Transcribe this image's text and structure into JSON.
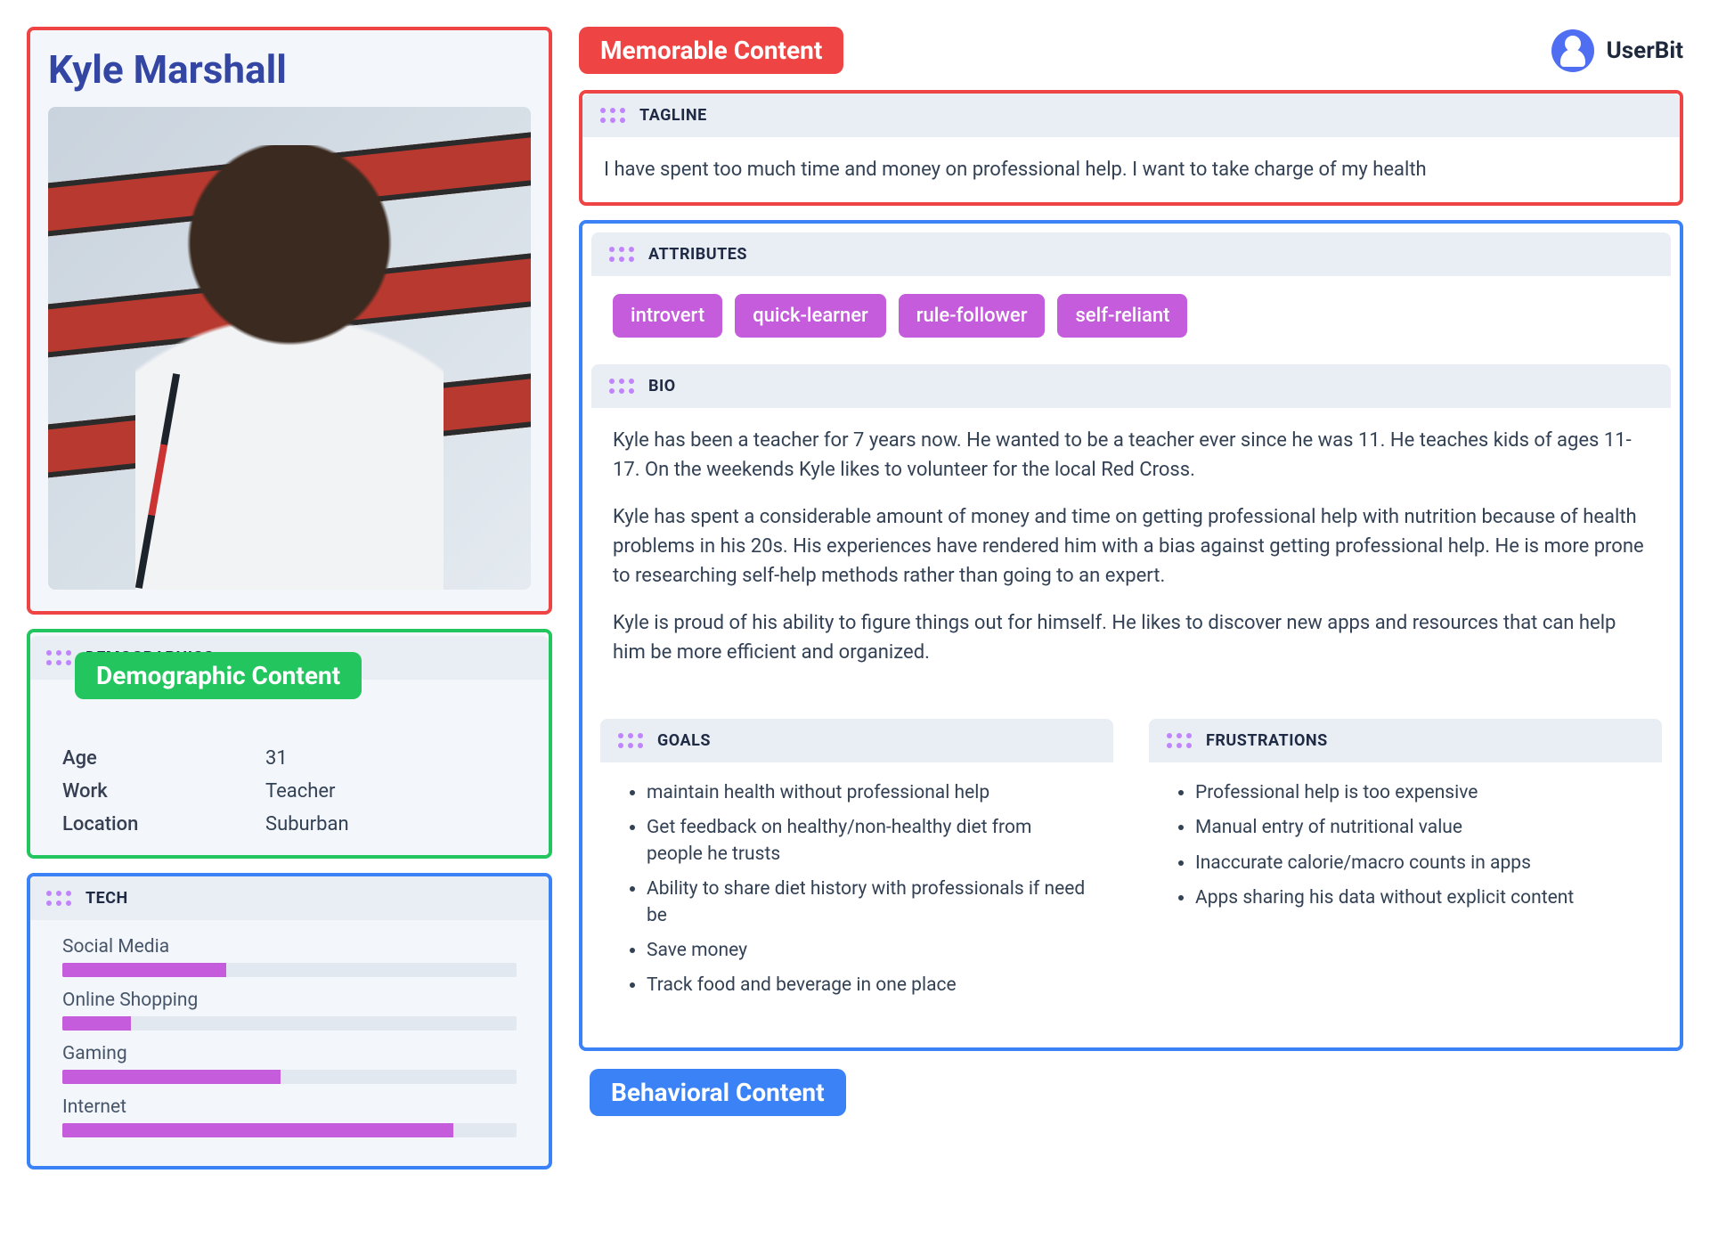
{
  "brand": {
    "name": "UserBit"
  },
  "annotations": {
    "memorable": "Memorable Content",
    "demographic": "Demographic Content",
    "behavioral": "Behavioral Content"
  },
  "persona": {
    "name": "Kyle Marshall",
    "tagline_heading": "TAGLINE",
    "tagline": "I have spent too much time and money on professional help. I want to take charge of my health",
    "attributes_heading": "ATTRIBUTES",
    "attributes": [
      "introvert",
      "quick-learner",
      "rule-follower",
      "self-reliant"
    ],
    "bio_heading": "BIO",
    "bio": [
      "Kyle has been a teacher for 7 years now. He wanted to be a teacher ever since he was 11. He teaches kids of ages 11-17. On the weekends Kyle likes to volunteer for the local Red Cross.",
      "Kyle has spent a considerable amount of money and time on getting professional help with nutrition because of health problems in his 20s. His experiences have rendered him with a bias against getting professional help. He is more prone to researching self-help methods rather than going to an expert.",
      "Kyle is proud of his ability to figure things out for himself. He likes to discover new apps and resources that can help him be more efficient and organized."
    ],
    "demographics_heading": "DEMOGRAPHICS",
    "demographics": [
      {
        "k": "Age",
        "v": "31"
      },
      {
        "k": "Work",
        "v": "Teacher"
      },
      {
        "k": "Location",
        "v": "Suburban"
      }
    ],
    "tech_heading": "TECH",
    "tech": [
      {
        "label": "Social Media",
        "pct": 36
      },
      {
        "label": "Online Shopping",
        "pct": 15
      },
      {
        "label": "Gaming",
        "pct": 48
      },
      {
        "label": "Internet",
        "pct": 86
      }
    ],
    "goals_heading": "GOALS",
    "goals": [
      "maintain health without professional help",
      "Get feedback on healthy/non-healthy diet from people he trusts",
      "Ability to share diet history with professionals if need be",
      "Save money",
      "Track food and beverage in one place"
    ],
    "frustrations_heading": "FRUSTRATIONS",
    "frustrations": [
      "Professional help is too expensive",
      "Manual entry of nutritional value",
      "Inaccurate calorie/macro counts in apps",
      "Apps sharing his data without explicit content"
    ]
  },
  "chart_data": {
    "type": "bar",
    "title": "TECH",
    "categories": [
      "Social Media",
      "Online Shopping",
      "Gaming",
      "Internet"
    ],
    "values": [
      36,
      15,
      48,
      86
    ],
    "xlabel": "",
    "ylabel": "",
    "ylim": [
      0,
      100
    ]
  }
}
